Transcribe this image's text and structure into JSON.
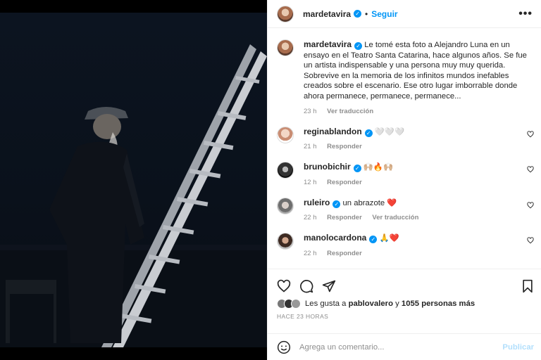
{
  "post": {
    "author": "mardetavira",
    "follow_label": "Seguir",
    "more_label": "•••",
    "separator": "•"
  },
  "caption": {
    "author": "mardetavira",
    "text": "Le tomé esta foto a Alejandro Luna en un ensayo en el Teatro Santa Catarina, hace algunos años. Se fue un artista indispensable y una persona muy muy querida. Sobrevive en la memoria de los infinitos mundos inefables creados sobre el escenario. Ese otro lugar imborrable donde ahora permanece, permanece, permanece...",
    "time": "23 h",
    "translate": "Ver traducción"
  },
  "comments": [
    {
      "user": "reginablandon",
      "text": "🤍🤍🤍",
      "time": "21 h",
      "reply": "Responder",
      "translate": ""
    },
    {
      "user": "brunobichir",
      "text": "🙌🏼🔥🙌🏼",
      "time": "12 h",
      "reply": "Responder",
      "translate": ""
    },
    {
      "user": "ruleiro",
      "text": "un abrazote ❤️",
      "time": "22 h",
      "reply": "Responder",
      "translate": "Ver traducción"
    },
    {
      "user": "manolocardona",
      "text": "🙏❤️",
      "time": "22 h",
      "reply": "Responder",
      "translate": ""
    }
  ],
  "likes": {
    "prefix": "Les gusta a",
    "user": "pablovalero",
    "joiner": "y",
    "count": "1055 personas más"
  },
  "posted_ago": "HACE 23 HORAS",
  "composer": {
    "placeholder": "Agrega un comentario...",
    "publish": "Publicar"
  },
  "colors": {
    "accent": "#0095f6",
    "muted": "#8e8e8e",
    "publish_disabled": "#b2dffc"
  },
  "icons": [
    "heart-icon",
    "comment-icon",
    "share-icon",
    "bookmark-icon",
    "emoji-icon",
    "verified-icon",
    "more-icon"
  ]
}
